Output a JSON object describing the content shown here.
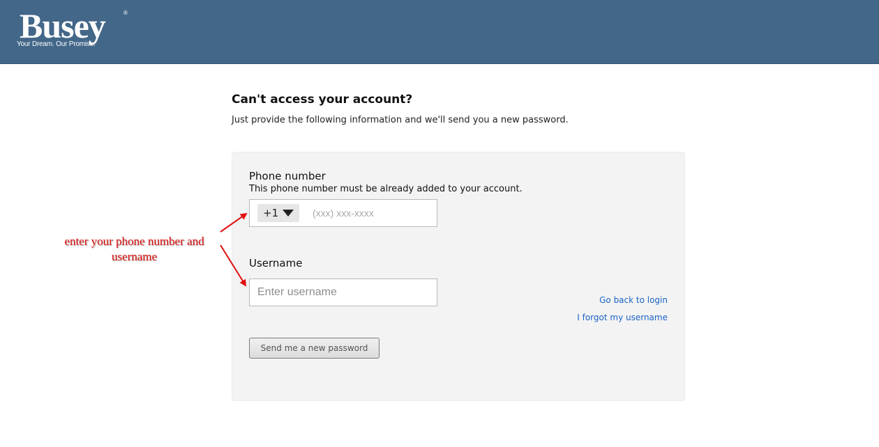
{
  "header": {
    "logo_text": "Busey",
    "logo_reg": "®",
    "tagline": "Your Dream. Our Promise.",
    "bg_color": "#436789"
  },
  "page": {
    "title": "Can't access your account?",
    "subtitle": "Just provide the following information and we'll send you a new password."
  },
  "form": {
    "phone_label": "Phone number",
    "phone_help": "This phone number must be already added to your account.",
    "country_code": "+1",
    "country_icon": "caret-down-icon",
    "phone_placeholder": "(xxx) xxx-xxxx",
    "phone_value": "",
    "username_label": "Username",
    "username_placeholder": "Enter username",
    "username_value": "",
    "submit_label": "Send me a new password"
  },
  "links": {
    "go_back": "Go back to login",
    "forgot_username": "I forgot my username",
    "color": "#1a63c7"
  },
  "annotation": {
    "text": "enter your phone number and username",
    "color": "#e01010"
  }
}
